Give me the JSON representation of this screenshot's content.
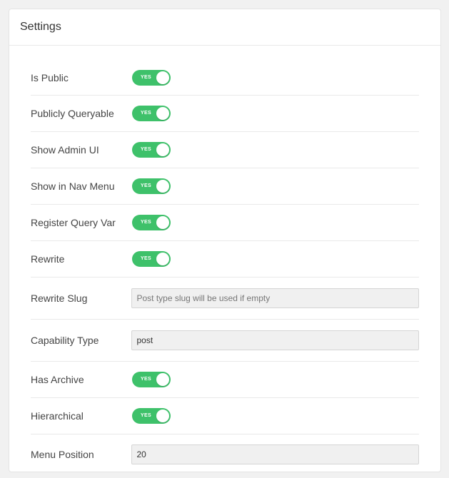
{
  "panel": {
    "title": "Settings"
  },
  "settings": {
    "is_public": {
      "label": "Is Public",
      "toggle_text": "YES",
      "value": true
    },
    "publicly_queryable": {
      "label": "Publicly Queryable",
      "toggle_text": "YES",
      "value": true
    },
    "show_admin_ui": {
      "label": "Show Admin UI",
      "toggle_text": "YES",
      "value": true
    },
    "show_in_nav_menu": {
      "label": "Show in Nav Menu",
      "toggle_text": "YES",
      "value": true
    },
    "register_query_var": {
      "label": "Register Query Var",
      "toggle_text": "YES",
      "value": true
    },
    "rewrite": {
      "label": "Rewrite",
      "toggle_text": "YES",
      "value": true
    },
    "rewrite_slug": {
      "label": "Rewrite Slug",
      "value": "",
      "placeholder": "Post type slug will be used if empty"
    },
    "capability_type": {
      "label": "Capability Type",
      "value": "post",
      "placeholder": ""
    },
    "has_archive": {
      "label": "Has Archive",
      "toggle_text": "YES",
      "value": true
    },
    "hierarchical": {
      "label": "Hierarchical",
      "toggle_text": "YES",
      "value": true
    },
    "menu_position": {
      "label": "Menu Position",
      "value": "20",
      "placeholder": ""
    }
  },
  "colors": {
    "toggle_on": "#3ec16a",
    "input_bg": "#f0f0f0",
    "divider": "#e9e9e9"
  }
}
